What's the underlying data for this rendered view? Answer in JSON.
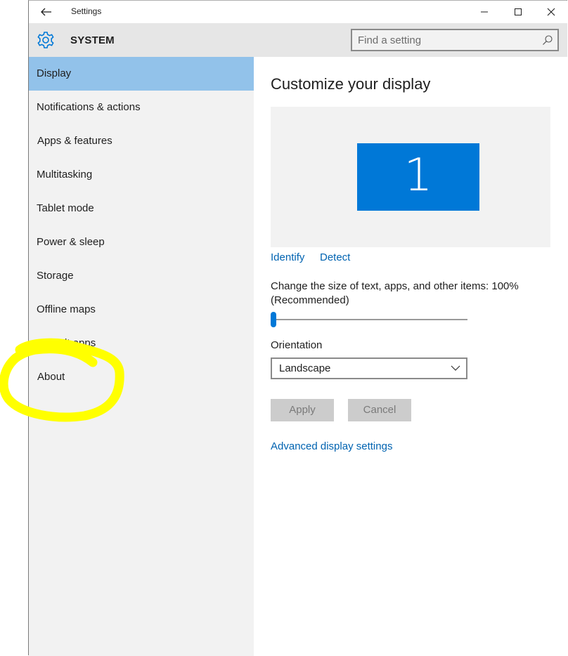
{
  "titlebar": {
    "title": "Settings",
    "back_icon": "back-arrow-icon",
    "minimize_icon": "minimize-icon",
    "maximize_icon": "maximize-icon",
    "close_icon": "close-icon"
  },
  "header": {
    "title": "SYSTEM",
    "icon": "gear-icon",
    "search_placeholder": "Find a setting",
    "search_value": "",
    "search_icon": "search-icon"
  },
  "sidebar": {
    "items": [
      {
        "label": "Display",
        "active": true
      },
      {
        "label": "Notifications & actions",
        "active": false
      },
      {
        "label": "Apps & features",
        "active": false
      },
      {
        "label": "Multitasking",
        "active": false
      },
      {
        "label": "Tablet mode",
        "active": false
      },
      {
        "label": "Power & sleep",
        "active": false
      },
      {
        "label": "Storage",
        "active": false
      },
      {
        "label": "Offline maps",
        "active": false
      },
      {
        "label": "Default apps",
        "active": false
      },
      {
        "label": "About",
        "active": false
      }
    ]
  },
  "main": {
    "title": "Customize your display",
    "monitor_number": "1",
    "identify_label": "Identify",
    "detect_label": "Detect",
    "scale_label": "Change the size of text, apps, and other items: 100% (Recommended)",
    "scale_fraction": 0,
    "orientation_label": "Orientation",
    "orientation_value": "Landscape",
    "apply_label": "Apply",
    "cancel_label": "Cancel",
    "advanced_link": "Advanced display settings"
  },
  "colors": {
    "accent": "#0078d7",
    "link": "#0063b1",
    "sidebar_active": "#92c2ea",
    "sidebar_bg": "#f2f2f2",
    "header_bg": "#e6e6e6",
    "annotation": "#ffff00"
  }
}
